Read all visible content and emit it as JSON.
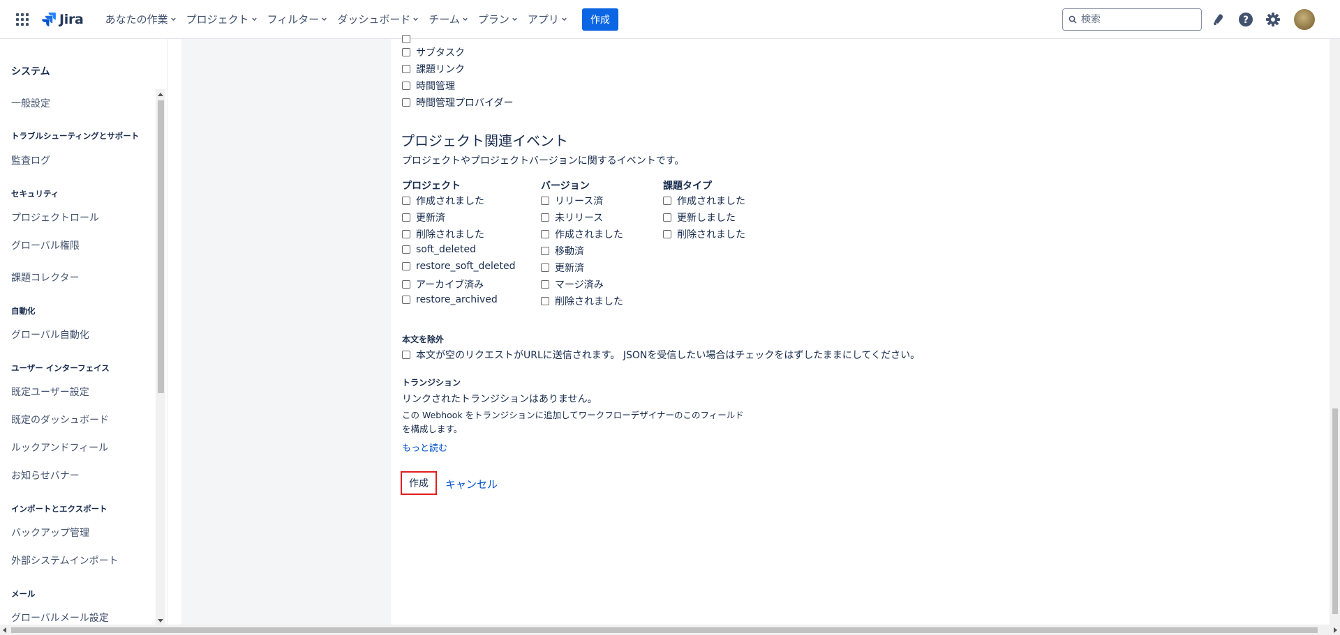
{
  "topbar": {
    "app_name": "Jira",
    "nav": [
      "あなたの作業",
      "プロジェクト",
      "フィルター",
      "ダッシュボード",
      "チーム",
      "プラン",
      "アプリ"
    ],
    "create_label": "作成",
    "search_placeholder": "検索",
    "accent_color": "#0c66e4"
  },
  "sidebar": {
    "title": "システム",
    "general_settings": "一般設定",
    "sections": {
      "troubleshooting": "トラブルシューティングとサポート",
      "security": "セキュリティ",
      "automation": "自動化",
      "ui": "ユーザー インターフェイス",
      "import_export": "インポートとエクスポート",
      "mail": "メール"
    },
    "items": {
      "audit_log": "監査ログ",
      "project_roles": "プロジェクトロール",
      "global_permissions": "グローバル権限",
      "issue_collector": "課題コレクター",
      "global_automation": "グローバル自動化",
      "default_user_settings": "既定ユーザー設定",
      "default_dashboard": "既定のダッシュボード",
      "look_and_feel": "ルックアンドフィール",
      "announcement_banner": "お知らせバナー",
      "backup_manager": "バックアップ管理",
      "external_import": "外部システムインポート",
      "global_mail_settings": "グローバルメール設定"
    }
  },
  "issue_events_tail": [
    "サブタスク",
    "課題リンク",
    "時間管理",
    "時間管理プロバイダー"
  ],
  "project_events": {
    "title": "プロジェクト関連イベント",
    "description": "プロジェクトやプロジェクトバージョンに関するイベントです。",
    "columns": [
      {
        "heading": "プロジェクト",
        "items": [
          "作成されました",
          "更新済",
          "削除されました",
          "soft_deleted",
          "restore_soft_deleted",
          "アーカイブ済み",
          "restore_archived"
        ]
      },
      {
        "heading": "バージョン",
        "items": [
          "リリース済",
          "未リリース",
          "作成されました",
          "移動済",
          "更新済",
          "マージ済み",
          "削除されました"
        ]
      },
      {
        "heading": "課題タイプ",
        "items": [
          "作成されました",
          "更新しました",
          "削除されました"
        ]
      }
    ]
  },
  "exclude_body": {
    "label": "本文を除外",
    "checkbox_text": "本文が空のリクエストがURLに送信されます。 JSONを受信したい場合はチェックをはずしたままにしてください。"
  },
  "transitions": {
    "label": "トランジション",
    "none_text": "リンクされたトランジションはありません。",
    "help_text": "この Webhook をトランジションに追加してワークフローデザイナーのこのフィールドを構成します。",
    "more_link": "もっと読む"
  },
  "actions": {
    "create": "作成",
    "cancel": "キャンセル"
  }
}
